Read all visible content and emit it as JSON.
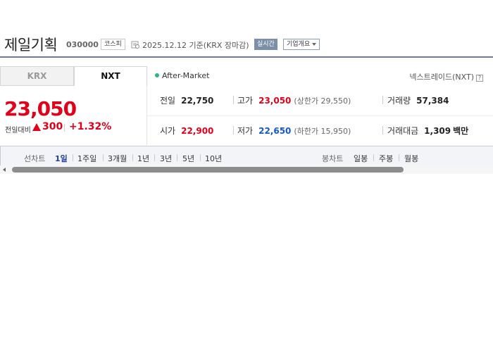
{
  "header": {
    "company_name": "제일기획",
    "code": "030000",
    "market": "코스피",
    "date": "2025.12.12",
    "basis": "기준(KRX 장마감)",
    "realtime": "실시간",
    "overview": "기업개요"
  },
  "tabs": [
    {
      "label": "KRX",
      "active": false
    },
    {
      "label": "NXT",
      "active": true
    }
  ],
  "session": {
    "status": "After-Market",
    "venue": "넥스트레이드(NXT)",
    "help": "?"
  },
  "quote": {
    "price": "23,050",
    "change_label": "전일대비",
    "change_value": "300",
    "change_rate": "+1.32%",
    "direction": "up",
    "colors": {
      "up": "#e0001a",
      "down": "#1459c9"
    }
  },
  "stats": {
    "prev_close": {
      "label": "전일",
      "value": "22,750"
    },
    "high": {
      "label": "고가",
      "value": "23,050",
      "sub": "(상한가 29,550)"
    },
    "volume": {
      "label": "거래량",
      "value": "57,384"
    },
    "open": {
      "label": "시가",
      "value": "22,900"
    },
    "low": {
      "label": "저가",
      "value": "22,650",
      "sub": "(하한가 15,950)"
    },
    "turnover": {
      "label": "거래대금",
      "value": "1,309",
      "unit": "백만"
    }
  },
  "chart_tabs": {
    "line_label": "선차트",
    "line_periods": [
      "1일",
      "1주일",
      "3개월",
      "1년",
      "3년",
      "5년",
      "10년"
    ],
    "active_period": "1일",
    "candle_label": "봉차트",
    "candle_periods": [
      "일봉",
      "주봉",
      "월봉"
    ]
  }
}
